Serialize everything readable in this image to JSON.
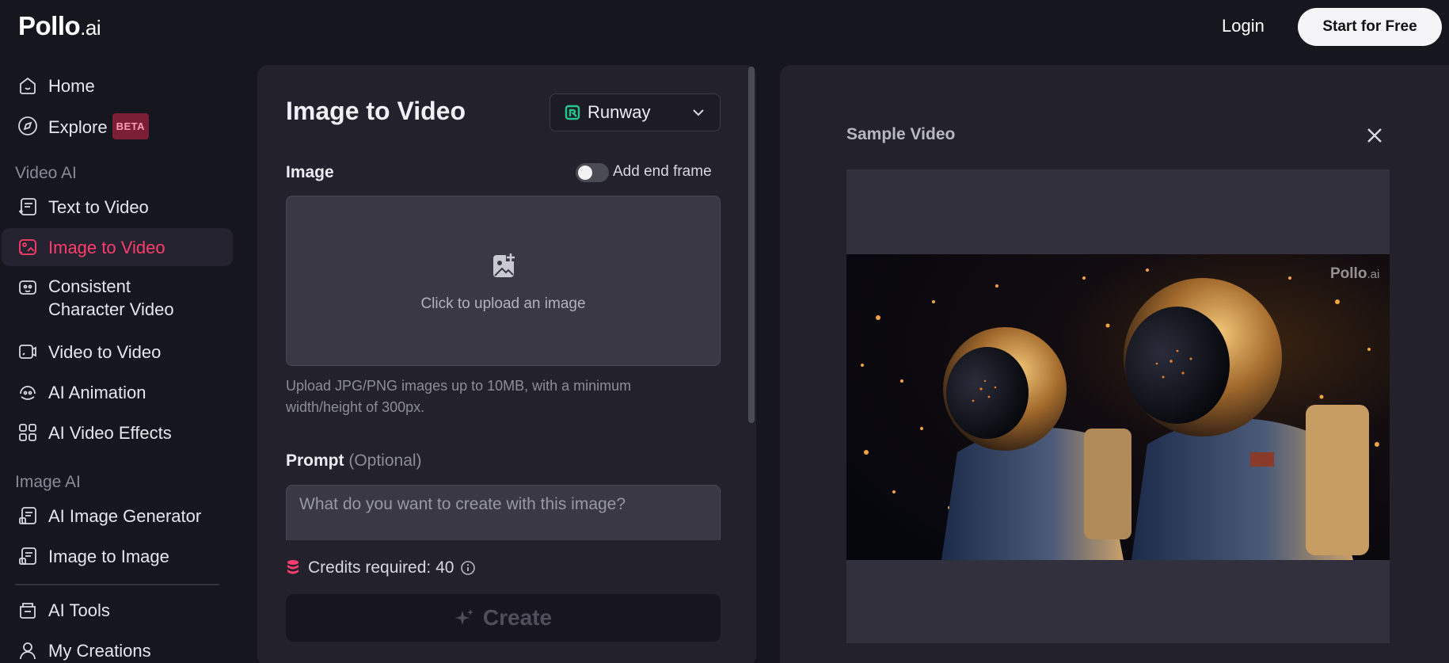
{
  "brand": {
    "name": "Pollo",
    "suffix": ".ai"
  },
  "header": {
    "login_label": "Login",
    "start_label": "Start for Free"
  },
  "sidebar": {
    "home": "Home",
    "explore": "Explore",
    "explore_badge": "BETA",
    "video_section": "Video AI",
    "video_items": [
      "Text to Video",
      "Image to Video",
      "Consistent\nCharacter Video",
      "Video to Video",
      "AI Animation",
      "AI Video Effects"
    ],
    "image_section": "Image AI",
    "image_items": [
      "AI Image Generator",
      "Image to Image"
    ],
    "tools": "AI Tools",
    "creations": "My Creations",
    "active_item": "Image to Video"
  },
  "form": {
    "title": "Image to Video",
    "model": "Runway",
    "image_label": "Image",
    "end_frame_label": "Add end frame",
    "end_frame_enabled": false,
    "upload_text": "Click to upload an image",
    "hint": "Upload JPG/PNG images up to 10MB, with a minimum width/height of 300px.",
    "prompt_label": "Prompt",
    "prompt_optional": "(Optional)",
    "prompt_placeholder": "What do you want to create with this image?",
    "credits_label": "Credits required: 40",
    "create_label": "Create"
  },
  "sample": {
    "title": "Sample Video",
    "watermark_name": "Pollo",
    "watermark_suffix": ".ai"
  },
  "colors": {
    "accent": "#ff3d6e",
    "runway_green": "#22c58b",
    "background": "#16161e",
    "panel": "#22212c"
  },
  "icons": {
    "home": "home-icon",
    "explore": "compass-icon",
    "text_to_video": "text-video-icon",
    "image_to_video": "image-video-icon",
    "character": "character-icon",
    "video_to_video": "video-video-icon",
    "animation": "animation-icon",
    "effects": "effects-icon",
    "image_gen": "image-gen-icon",
    "image_to_image": "image-image-icon",
    "tools": "tools-icon",
    "creations": "user-icon"
  }
}
